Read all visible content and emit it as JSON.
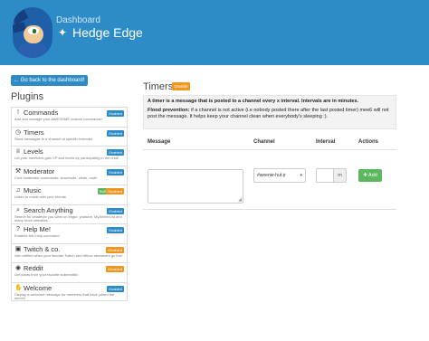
{
  "header": {
    "subtitle": "Dashboard",
    "title": "Hedge Edge",
    "icon": "puzzle-icon"
  },
  "back_button": "← Go back to the dashboard!",
  "plugins_title": "Plugins",
  "plugins": [
    {
      "name": "Commands",
      "icon": "exclamation-icon",
      "desc": "Add and manage your AWESOME custom commands!",
      "badges": [
        {
          "label": "Enabled",
          "type": "enabled"
        }
      ]
    },
    {
      "name": "Timers",
      "icon": "clock-icon",
      "desc": "Send messages in a channel at specific intervals",
      "badges": [
        {
          "label": "Enabled",
          "type": "enabled"
        }
      ]
    },
    {
      "name": "Levels",
      "icon": "trophy-icon",
      "desc": "Let your members gain XP and levels by participating in the chat!",
      "badges": [
        {
          "label": "Enabled",
          "type": "enabled"
        }
      ]
    },
    {
      "name": "Moderator",
      "icon": "gavel-icon",
      "desc": "Cool moderator commands: slowmode, clean, mute",
      "badges": [
        {
          "label": "Enabled",
          "type": "enabled"
        }
      ]
    },
    {
      "name": "Music",
      "icon": "music-icon",
      "desc": "Listen to music with your friends",
      "badges": [
        {
          "label": "Buff",
          "type": "buff"
        },
        {
          "label": "Disabled",
          "type": "disabled"
        }
      ]
    },
    {
      "name": "Search Anything",
      "icon": "search-icon",
      "desc": "Search for whatever you want on imgur, youtube, MyAnimeList and many more websites...",
      "badges": [
        {
          "label": "Enabled",
          "type": "enabled"
        }
      ]
    },
    {
      "name": "Help Me!",
      "icon": "question-icon",
      "desc": "Enables the !help command",
      "badges": [
        {
          "label": "Enabled",
          "type": "enabled"
        }
      ]
    },
    {
      "name": "Twitch & co.",
      "icon": "twitch-icon",
      "desc": "Get notified when your favorite Twitch and Hitbox streamers go live!",
      "badges": [
        {
          "label": "Disabled",
          "type": "disabled"
        }
      ]
    },
    {
      "name": "Reddit",
      "icon": "reddit-icon",
      "desc": "Get posts from your favorite subreddits!",
      "badges": [
        {
          "label": "Disabled",
          "type": "disabled"
        }
      ]
    },
    {
      "name": "Welcome",
      "icon": "handshake-icon",
      "desc": "Display a welcome message for members that have joined the server!",
      "badges": [
        {
          "label": "Enabled",
          "type": "enabled"
        }
      ]
    }
  ],
  "section": {
    "title": "Timers",
    "disable_label": "Disable"
  },
  "info": {
    "line1": "A timer is a message that is posted to a channel every x interval. Intervals are in minutes.",
    "flood_label": "Flood prevention:",
    "flood_text": " if a channel is not active (i.e nobody posted there after the last posted timer) mee6 will not post the message. It helps keep your channel clean when everybody's sleeping :)."
  },
  "table": {
    "col_message": "Message",
    "col_channel": "Channel",
    "col_interval": "Interval",
    "col_actions": "Actions",
    "channel_value": "#weenie-hut-jr",
    "interval_unit": "m",
    "add_label": "✚ Add"
  },
  "colors": {
    "header": "#2d8cc8",
    "enabled": "#2d8cc8",
    "disabled": "#f0961e",
    "buff": "#5cb85c",
    "add": "#5cb85c"
  }
}
